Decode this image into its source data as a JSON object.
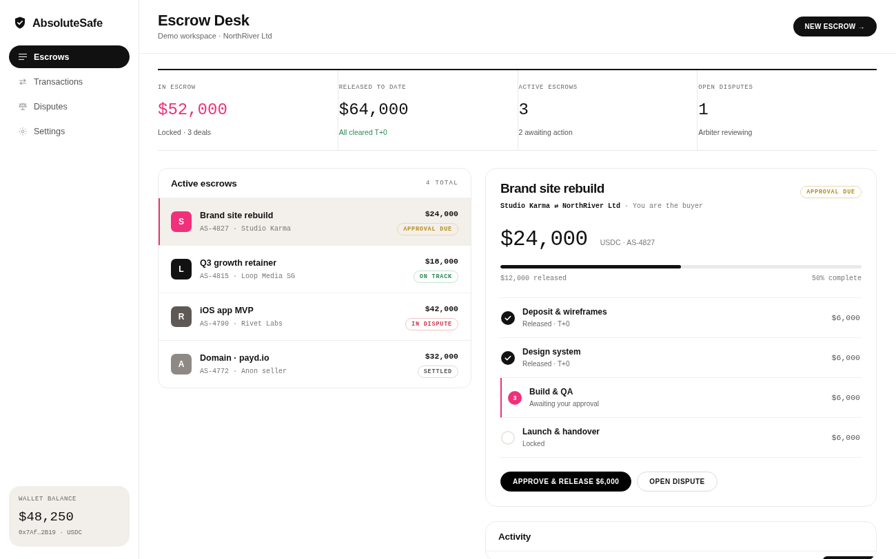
{
  "sidebar": {
    "brand": "AbsoluteSafe",
    "items": [
      {
        "label": "Escrows",
        "selected": true
      },
      {
        "label": "Transactions",
        "selected": false
      },
      {
        "label": "Disputes",
        "selected": false
      },
      {
        "label": "Settings",
        "selected": false
      }
    ],
    "wallet": {
      "label": "WALLET BALANCE",
      "amount": "$48,250",
      "address": "0x7Af…2B19 · USDC"
    }
  },
  "header": {
    "title": "Escrow Desk",
    "subtitle": "Demo workspace · NorthRiver Ltd",
    "button": "NEW ESCROW →"
  },
  "stats": [
    {
      "label": "IN ESCROW",
      "value": "$52,000",
      "note": "Locked · 3 deals",
      "kind": "alert"
    },
    {
      "label": "RELEASED TO DATE",
      "value": "$64,000",
      "note": "All cleared T+0",
      "kind": "positive"
    },
    {
      "label": "ACTIVE ESCROWS",
      "value": "3",
      "note": "2 awaiting action",
      "kind": "neutral"
    },
    {
      "label": "OPEN DISPUTES",
      "value": "1",
      "note": "Arbiter reviewing",
      "kind": "neutral"
    }
  ],
  "escrows": {
    "title": "Active escrows",
    "count": "4 TOTAL",
    "rows": [
      {
        "initial": "S",
        "color": "#f0307a",
        "name": "Brand site rebuild",
        "meta": "AS-4827 · Studio Karma",
        "amount": "$24,000",
        "status": {
          "label": "APPROVAL DUE",
          "kind": "approval"
        },
        "selected": true
      },
      {
        "initial": "L",
        "color": "#111111",
        "name": "Q3 growth retainer",
        "meta": "AS-4815 · Loop Media SG",
        "amount": "$18,000",
        "status": {
          "label": "ON TRACK",
          "kind": "on_track"
        },
        "selected": false
      },
      {
        "initial": "R",
        "color": "#5e5955",
        "name": "iOS app MVP",
        "meta": "AS-4790 · Rivet Labs",
        "amount": "$42,000",
        "status": {
          "label": "IN DISPUTE",
          "kind": "dispute"
        },
        "selected": false
      },
      {
        "initial": "A",
        "color": "#8e8984",
        "name": "Domain · payd.io",
        "meta": "AS-4772 · Anon seller",
        "amount": "$32,000",
        "status": {
          "label": "SETTLED",
          "kind": "settled"
        },
        "selected": false
      }
    ]
  },
  "detail": {
    "title": "Brand site rebuild",
    "status": {
      "label": "APPROVAL DUE",
      "kind": "approval"
    },
    "parties": "**Studio Karma ⇄ NorthRiver Ltd** · You are the buyer",
    "amount": "$24,000",
    "currency": "USDC · AS-4827",
    "progress": {
      "level": 0.5,
      "released": "$12,000 released",
      "complete": "50% complete"
    },
    "milestones": [
      {
        "kind": "done",
        "title": "Deposit & wireframes",
        "note": "Released · T+0",
        "amount": "$6,000"
      },
      {
        "kind": "done",
        "title": "Design system",
        "note": "Released · T+0",
        "amount": "$6,000"
      },
      {
        "kind": "current",
        "step": "3",
        "title": "Build & QA",
        "note": "Awaiting your approval",
        "amount": "$6,000"
      },
      {
        "kind": "locked",
        "title": "Launch & handover",
        "note": "Locked",
        "amount": "$6,000"
      }
    ],
    "actions": [
      {
        "label": "APPROVE & RELEASE $6,000",
        "kind": "primary"
      },
      {
        "label": "OPEN DISPUTE",
        "kind": "secondary"
      }
    ]
  },
  "activity": {
    "title": "Activity"
  }
}
